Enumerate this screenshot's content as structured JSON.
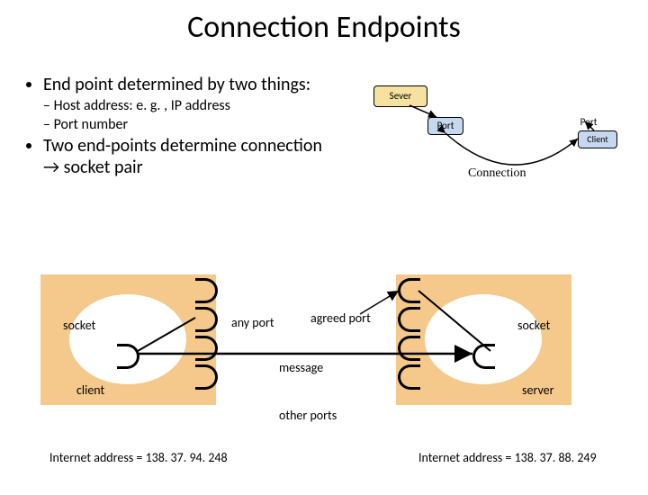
{
  "title": "Connection Endpoints",
  "bullets": {
    "b1": "End point determined by two things:",
    "b1a": "Host address: e. g. , IP address",
    "b1b": "Port number",
    "b2": "Two end-points determine connection → socket pair"
  },
  "mini": {
    "sever": "Sever",
    "port": "Port",
    "client": "Client",
    "connection": "Connection"
  },
  "lower": {
    "socket": "socket",
    "client": "client",
    "server": "server",
    "any_port": "any port",
    "agreed_port": "agreed port",
    "message": "message",
    "other_ports": "other ports",
    "addr_left": "Internet address = 138. 37. 94. 248",
    "addr_right": "Internet address = 138. 37. 88. 249"
  }
}
